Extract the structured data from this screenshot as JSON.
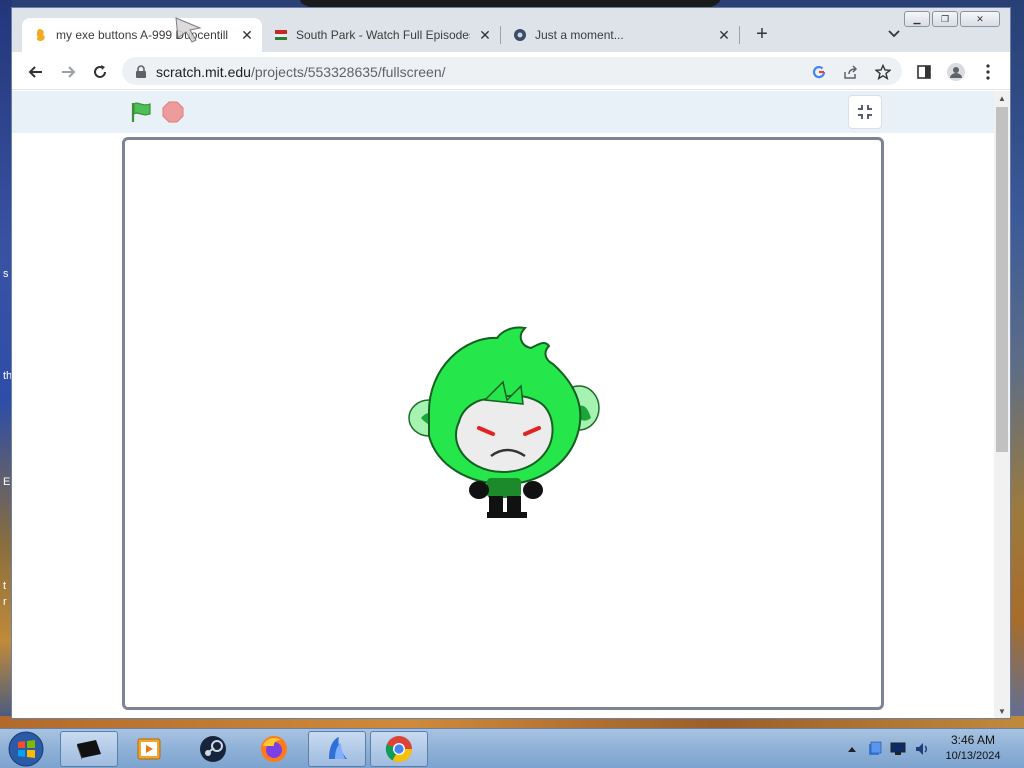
{
  "browser": {
    "tabs": [
      {
        "label": "my exe buttons A-999 Duocentill",
        "active": true
      },
      {
        "label": "South Park - Watch Full Episodes",
        "active": false
      },
      {
        "label": "Just a moment...",
        "active": false
      }
    ],
    "new_tab_label": "+",
    "address": {
      "host": "scratch.mit.edu",
      "path": "/projects/553328635/fullscreen/"
    },
    "window_buttons": [
      "minimize",
      "restore",
      "close"
    ]
  },
  "player": {
    "green_flag": "green-flag-icon",
    "stop": "stop-sign-icon",
    "exit_fullscreen": "exit-fullscreen-icon",
    "sprite": "angry-green-hooded-character"
  },
  "taskbar": {
    "items": [
      "media-center-icon",
      "windows-media-player-icon",
      "steam-icon",
      "firefox-icon",
      "blue-app-icon",
      "chrome-icon"
    ],
    "clock": {
      "time": "3:46 AM",
      "date": "10/13/2024"
    }
  },
  "desktop": {
    "edge_letters": [
      "s",
      "th",
      "E",
      "t",
      "r"
    ]
  },
  "colors": {
    "accent_green": "#1fbf3a",
    "stage_border": "#7d8592",
    "header_bg": "#e8f0f8"
  }
}
